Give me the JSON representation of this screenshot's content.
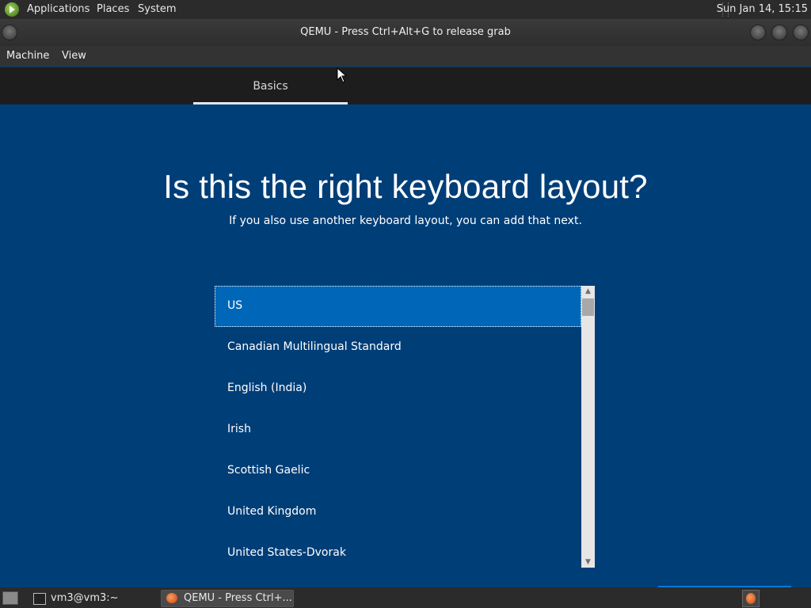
{
  "top_panel": {
    "menus": [
      "Applications",
      "Places",
      "System"
    ],
    "clock": "Sun Jan 14, 15:15"
  },
  "window": {
    "title": "QEMU - Press Ctrl+Alt+G to release grab",
    "menubar": [
      "Machine",
      "View"
    ]
  },
  "setup": {
    "tab": "Basics",
    "heading": "Is this the right keyboard layout?",
    "subheading": "If you also use another keyboard layout, you can add that next.",
    "layouts": [
      "US",
      "Canadian Multilingual Standard",
      "English (India)",
      "Irish",
      "Scottish Gaelic",
      "United Kingdom",
      "United States-Dvorak"
    ],
    "selected_index": 0,
    "accent_color": "#0067b8",
    "background_color": "#003e78"
  },
  "taskbar": {
    "items": [
      "vm3@vm3:~",
      "QEMU - Press Ctrl+..."
    ]
  }
}
